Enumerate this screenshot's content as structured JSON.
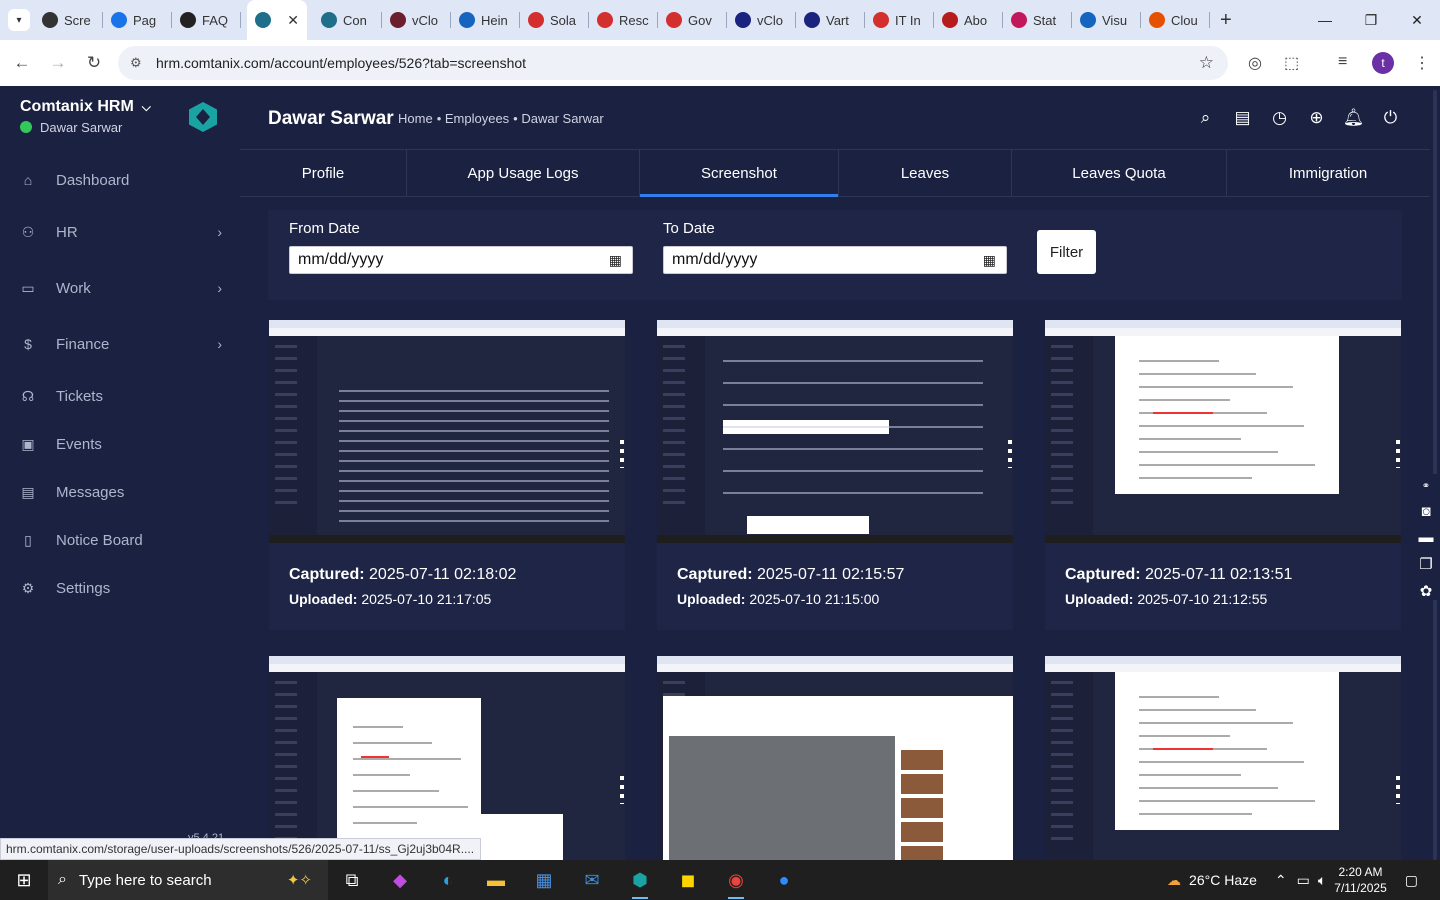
{
  "browser": {
    "tabs": [
      {
        "title": "Scre",
        "color": "#333333"
      },
      {
        "title": "Pag",
        "color": "#1a73e8"
      },
      {
        "title": "FAQ",
        "color": "#222222"
      },
      {
        "title": "",
        "color": "#1f6f8b",
        "active": true
      },
      {
        "title": "Con",
        "color": "#1f6f8b"
      },
      {
        "title": "vClo",
        "color": "#6b1e2b"
      },
      {
        "title": "Hein",
        "color": "#1565c0"
      },
      {
        "title": "Sola",
        "color": "#d32f2f"
      },
      {
        "title": "Resc",
        "color": "#d32f2f"
      },
      {
        "title": "Gov",
        "color": "#d32f2f"
      },
      {
        "title": "vClo",
        "color": "#1a237e"
      },
      {
        "title": "Vart",
        "color": "#1a237e"
      },
      {
        "title": "IT In",
        "color": "#d32f2f"
      },
      {
        "title": "Abo",
        "color": "#b71c1c"
      },
      {
        "title": "Stat",
        "color": "#c2185b"
      },
      {
        "title": "Visu",
        "color": "#1565c0"
      },
      {
        "title": "Clou",
        "color": "#e65100"
      }
    ],
    "url": "hrm.comtanix.com/account/employees/526?tab=screenshot",
    "profile_initial": "t",
    "status_url": "hrm.comtanix.com/storage/user-uploads/screenshots/526/2025-07-11/ss_Gj2uj3b04R...."
  },
  "sidebar": {
    "app_name": "Comtanix HRM",
    "user": "Dawar Sarwar",
    "items": [
      {
        "label": "Dashboard",
        "icon": "home-icon",
        "chevron": false
      },
      {
        "label": "HR",
        "icon": "users-icon",
        "chevron": true
      },
      {
        "label": "Work",
        "icon": "briefcase-icon",
        "chevron": true
      },
      {
        "label": "Finance",
        "icon": "dollar-icon",
        "chevron": true
      },
      {
        "label": "Tickets",
        "icon": "headset-icon",
        "chevron": false
      },
      {
        "label": "Events",
        "icon": "calendar-icon",
        "chevron": false
      },
      {
        "label": "Messages",
        "icon": "message-icon",
        "chevron": false
      },
      {
        "label": "Notice Board",
        "icon": "clipboard-icon",
        "chevron": false
      },
      {
        "label": "Settings",
        "icon": "gear-icon",
        "chevron": false
      }
    ],
    "version": "v5.4.21"
  },
  "header": {
    "title": "Dawar Sarwar",
    "breadcrumb": [
      "Home",
      "Employees",
      "Dawar Sarwar"
    ]
  },
  "tabs": [
    "Profile",
    "App Usage Logs",
    "Screenshot",
    "Leaves",
    "Leaves Quota",
    "Immigration"
  ],
  "active_tab": "Screenshot",
  "filter": {
    "from_label": "From Date",
    "to_label": "To Date",
    "from_value": "mm/dd/yyyy",
    "to_value": "mm/dd/yyyy",
    "button": "Filter"
  },
  "captured_label": "Captured:",
  "uploaded_label": "Uploaded:",
  "screenshots": [
    {
      "captured": "2025-07-11 02:18:02",
      "uploaded": "2025-07-10 21:17:05"
    },
    {
      "captured": "2025-07-11 02:15:57",
      "uploaded": "2025-07-10 21:15:00"
    },
    {
      "captured": "2025-07-11 02:13:51",
      "uploaded": "2025-07-10 21:12:55"
    },
    {
      "captured": "",
      "uploaded": ""
    },
    {
      "captured": "",
      "uploaded": ""
    },
    {
      "captured": "",
      "uploaded": ""
    }
  ],
  "taskbar": {
    "search_placeholder": "Type here to search",
    "weather": "26°C  Haze",
    "time": "2:20 AM",
    "date": "7/11/2025"
  }
}
